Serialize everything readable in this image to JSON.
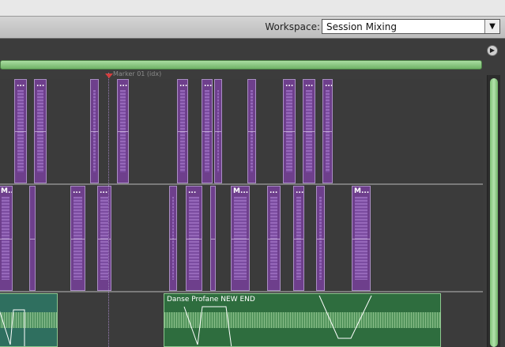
{
  "workspace": {
    "label": "Workspace:",
    "value": "Session Mixing",
    "arrow": "▼"
  },
  "marker": {
    "label": "Marker 01 (idx)"
  },
  "nav": {
    "button_glyph": "▶"
  },
  "track1": {
    "clip_label": "..."
  },
  "track2": {
    "clip_label_m": "M...",
    "clip_label_dots": "..."
  },
  "track3": {
    "clip_label": "Danse Profane NEW END"
  },
  "colors": {
    "purple_clip": "#6e3f8c",
    "green_clip": "#2e6d3e",
    "marker": "#d43f3f",
    "nav_green": "#8fd087"
  }
}
